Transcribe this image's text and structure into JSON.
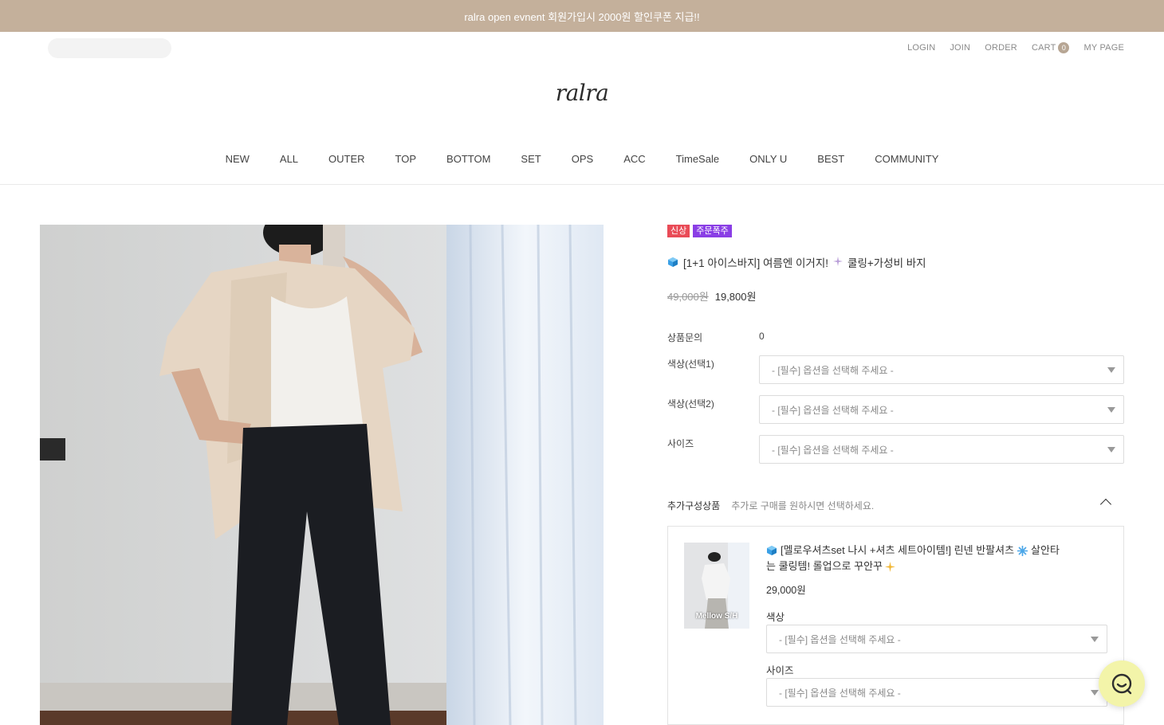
{
  "topbar": {
    "text": "ralra open evnent 회원가입시 2000원 할인쿠폰 지급!!"
  },
  "util": {
    "login": "LOGIN",
    "join": "JOIN",
    "order": "ORDER",
    "cart": "CART",
    "cart_count": "0",
    "mypage": "MY PAGE"
  },
  "logo": "ralra",
  "nav": [
    "NEW",
    "ALL",
    "OUTER",
    "TOP",
    "BOTTOM",
    "SET",
    "OPS",
    "ACC",
    "TimeSale",
    "ONLY U",
    "BEST",
    "COMMUNITY"
  ],
  "product": {
    "badges": {
      "new": "신상",
      "hot": "주문폭주"
    },
    "title": "[1+1 아이스바지] 여름엔 이거지!",
    "title_tail": "쿨링+가성비 바지",
    "price_original": "49,000원",
    "price_sale": "19,800원",
    "qna_label": "상품문의",
    "qna_value": "0",
    "options": [
      {
        "label": "색상(선택1)",
        "placeholder": "- [필수] 옵션을 선택해 주세요 -"
      },
      {
        "label": "색상(선택2)",
        "placeholder": "- [필수] 옵션을 선택해 주세요 -"
      },
      {
        "label": "사이즈",
        "placeholder": "- [필수] 옵션을 선택해 주세요 -"
      }
    ]
  },
  "additional": {
    "title": "추가구성상품",
    "subtitle": "추가로 구매를 원하시면 선택하세요.",
    "item": {
      "thumb_label": "Mellow S/H",
      "title_line1": "[멜로우셔츠set 나시 +셔츠 세트아이템!] 린넨 반팔셔츠",
      "title_line1_tail": "살안타",
      "title_line2": "는 쿨링템! 롤업으로 꾸안꾸",
      "price": "29,000원",
      "color_label": "색상",
      "color_placeholder": "- [필수] 옵션을 선택해 주세요 -",
      "size_label": "사이즈",
      "size_placeholder": "- [필수] 옵션을 선택해 주세요 -"
    }
  },
  "colors": {
    "topbar": "#c4b09b",
    "badge_new": "#e94b57",
    "badge_hot": "#8a3ee5",
    "chat": "#f3f4a9"
  },
  "icons": {
    "cube": "cube-icon",
    "sparkle": "sparkle-icon",
    "snow": "snowflake-icon",
    "chat": "chat-icon",
    "chevron": "chevron-up-icon"
  }
}
